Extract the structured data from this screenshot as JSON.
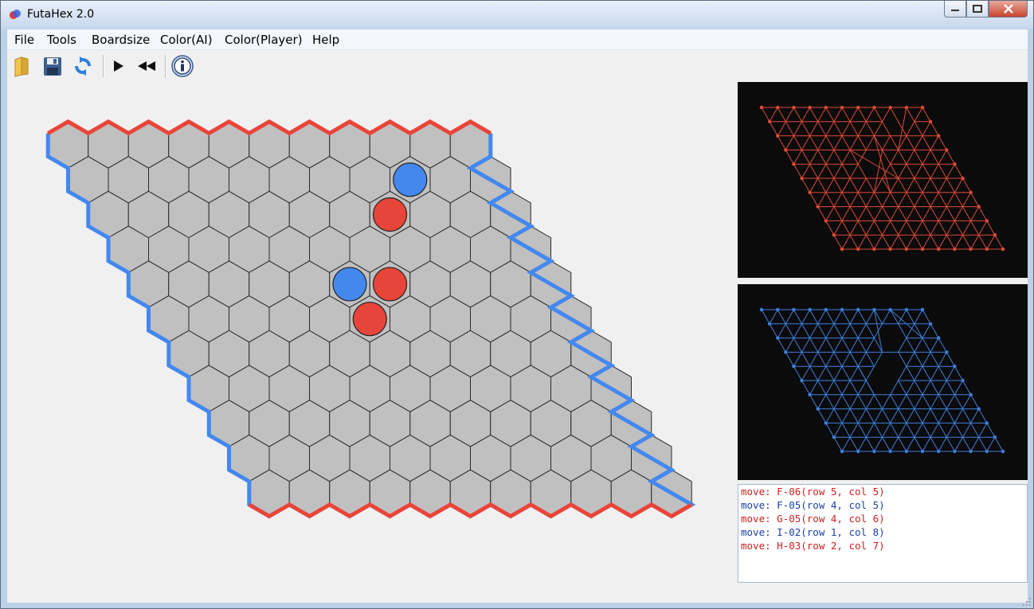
{
  "window": {
    "title": "FutaHex 2.0"
  },
  "menu": [
    "File",
    "Tools",
    "Boardsize",
    "Color(AI)",
    "Color(Player)",
    "Help"
  ],
  "toolbar": {
    "buttons": [
      "open-folder-icon",
      "save-icon",
      "refresh-icon",
      "play-icon",
      "rewind-icon",
      "info-icon"
    ]
  },
  "board": {
    "size": 11,
    "cell_color": "#c0c0c0",
    "red_color": "#e8453a",
    "blue_color": "#4488ee",
    "red_edges": "top-bottom",
    "blue_edges": "left-right",
    "stones": [
      {
        "row": 1,
        "col": 8,
        "color": "blue"
      },
      {
        "row": 2,
        "col": 7,
        "color": "red"
      },
      {
        "row": 4,
        "col": 5,
        "color": "blue"
      },
      {
        "row": 4,
        "col": 6,
        "color": "red"
      },
      {
        "row": 5,
        "col": 5,
        "color": "red"
      }
    ]
  },
  "graphs": {
    "red_color": "#dd4a3a",
    "blue_color": "#3f7fdc",
    "background": "#0b0b0b"
  },
  "log": {
    "entries": [
      {
        "text": "move: F-06(row 5, col 5)",
        "color": "#d21e1e"
      },
      {
        "text": "move: F-05(row 4, col 5)",
        "color": "#1a3fa8"
      },
      {
        "text": "move: G-05(row 4, col 6)",
        "color": "#d21e1e"
      },
      {
        "text": "move: I-02(row 1, col 8)",
        "color": "#1a3fa8"
      },
      {
        "text": "move: H-03(row 2, col 7)",
        "color": "#d21e1e"
      }
    ]
  }
}
